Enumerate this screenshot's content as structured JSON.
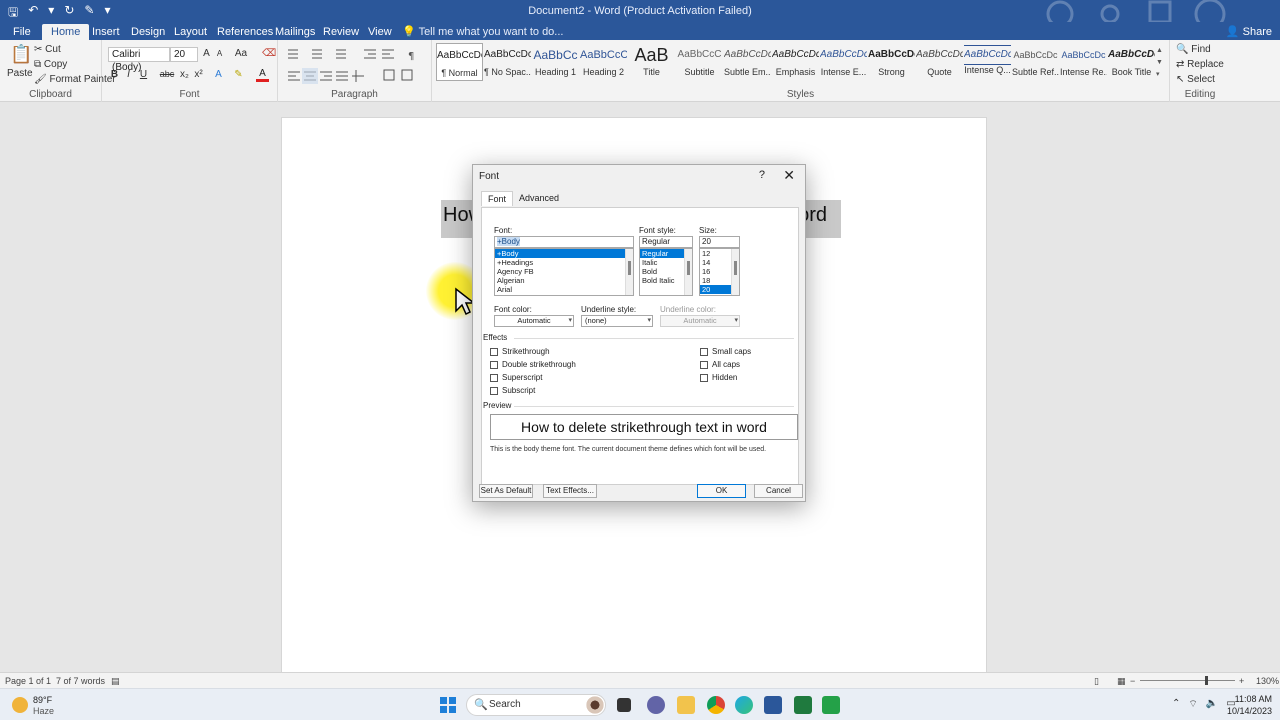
{
  "titlebar": {
    "title": "Document2 - Word (Product Activation Failed)",
    "qat": {
      "save_icon": "save-icon",
      "undo_icon": "undo-icon",
      "redo_icon": "redo-icon",
      "touch_icon": "touch-mode-icon",
      "customize_icon": "customize-qat-icon"
    },
    "symbols": {
      "save": "🖫",
      "undo": "↶",
      "undo_dropdown": "▾",
      "redo": "↻",
      "touch": "✎",
      "customize": "▾"
    }
  },
  "tabs": [
    "File",
    "Home",
    "Insert",
    "Design",
    "Layout",
    "References",
    "Mailings",
    "Review",
    "View"
  ],
  "active_tab": "Home",
  "tellme": "Tell me what you want to do...",
  "share": "Share",
  "ribbon": {
    "clipboard": {
      "label": "Clipboard",
      "paste": "Paste",
      "cut": "Cut",
      "copy": "Copy",
      "format_painter": "Format Painter"
    },
    "font": {
      "label": "Font",
      "font_name": "Calibri (Body)",
      "font_size": "20",
      "buttons": {
        "bold": "B",
        "italic": "I",
        "underline": "U",
        "strike": "abc",
        "subscript": "x₂",
        "superscript": "x²",
        "text_effects": "A",
        "highlight": "✎",
        "font_color": "A",
        "grow": "A",
        "shrink": "A",
        "change_case": "Aa",
        "clear": "⌫"
      }
    },
    "paragraph": {
      "label": "Paragraph"
    },
    "styles": {
      "label": "Styles",
      "items": [
        {
          "sample": "AaBbCcDc",
          "name": "¶ Normal"
        },
        {
          "sample": "AaBbCcDc",
          "name": "¶ No Spac..."
        },
        {
          "sample": "AaBbCc",
          "name": "Heading 1"
        },
        {
          "sample": "AaBbCcC",
          "name": "Heading 2"
        },
        {
          "sample": "AaB",
          "name": "Title"
        },
        {
          "sample": "AaBbCcC",
          "name": "Subtitle"
        },
        {
          "sample": "AaBbCcDc",
          "name": "Subtle Em..."
        },
        {
          "sample": "AaBbCcDc",
          "name": "Emphasis"
        },
        {
          "sample": "AaBbCcDc",
          "name": "Intense E..."
        },
        {
          "sample": "AaBbCcDc",
          "name": "Strong"
        },
        {
          "sample": "AaBbCcDc",
          "name": "Quote"
        },
        {
          "sample": "AaBbCcDc",
          "name": "Intense Q..."
        },
        {
          "sample": "AaBbCcDc",
          "name": "Subtle Ref..."
        },
        {
          "sample": "AaBbCcDc",
          "name": "Intense Re..."
        },
        {
          "sample": "AaBbCcDc",
          "name": "Book Title"
        }
      ]
    },
    "editing": {
      "label": "Editing",
      "find": "Find",
      "replace": "Replace",
      "select": "Select"
    }
  },
  "document": {
    "text_left": "How",
    "text_right": "ord"
  },
  "dialog": {
    "title": "Font",
    "help": "?",
    "close": "✕",
    "tabs": [
      "Font",
      "Advanced"
    ],
    "font_label": "Font:",
    "font_value": "+Body",
    "font_list": [
      "+Body",
      "+Headings",
      "Agency FB",
      "Algerian",
      "Arial"
    ],
    "style_label": "Font style:",
    "style_value": "Regular",
    "style_list": [
      "Regular",
      "Italic",
      "Bold",
      "Bold Italic"
    ],
    "size_label": "Size:",
    "size_value": "20",
    "size_list": [
      "12",
      "14",
      "16",
      "18",
      "20"
    ],
    "font_color_label": "Font color:",
    "font_color_value": "Automatic",
    "underline_style_label": "Underline style:",
    "underline_style_value": "(none)",
    "underline_color_label": "Underline color:",
    "underline_color_value": "Automatic",
    "effects_label": "Effects",
    "effects_left": [
      "Strikethrough",
      "Double strikethrough",
      "Superscript",
      "Subscript"
    ],
    "effects_right": [
      "Small caps",
      "All caps",
      "Hidden"
    ],
    "preview_label": "Preview",
    "preview_text": "How to delete strikethrough text in word",
    "preview_note": "This is the body theme font. The current document theme defines which font will be used.",
    "set_default": "Set As Default",
    "text_effects": "Text Effects...",
    "ok": "OK",
    "cancel": "Cancel"
  },
  "statusbar": {
    "page": "Page 1 of 1",
    "words": "7 of 7 words",
    "zoom": "130%",
    "zoom_minus": "−",
    "zoom_plus": "+"
  },
  "taskbar": {
    "weather_temp": "89°F",
    "weather_desc": "Haze",
    "search": "Search",
    "time": "11:08 AM",
    "date": "10/14/2023",
    "search_icon": "🔍",
    "tray": {
      "chevron": "⌃",
      "wifi": "⌔",
      "volume": "🔈",
      "battery": "▭"
    }
  },
  "colors": {
    "word_blue": "#2b579a",
    "selection_blue": "#0078d7"
  }
}
